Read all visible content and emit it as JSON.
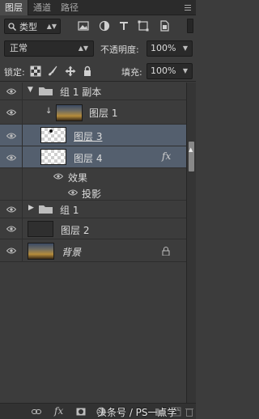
{
  "tabs": [
    {
      "label": "图层"
    },
    {
      "label": "通道"
    },
    {
      "label": "路径"
    }
  ],
  "filter": {
    "kind_label": "类型",
    "icons": [
      "search-icon",
      "image-filter-icon",
      "adjustment-filter-icon",
      "type-filter-icon",
      "shape-filter-icon",
      "smart-object-filter-icon"
    ]
  },
  "blend": {
    "mode": "正常",
    "opacity_label": "不透明度:",
    "opacity_value": "100%"
  },
  "lock": {
    "label": "锁定:",
    "icons": [
      "lock-transparent-icon",
      "lock-pixels-icon",
      "lock-position-icon",
      "lock-all-icon"
    ],
    "fill_label": "填充:",
    "fill_value": "100%"
  },
  "layers": {
    "group_copy": "组 1 副本",
    "layer1": "图层 1",
    "layer3": "图层 3",
    "layer4": "图层 4",
    "layer4_fx": "fx",
    "effects": "效果",
    "drop_shadow": "投影",
    "group1": "组 1",
    "layer2": "图层 2",
    "background": "背景"
  },
  "colors": {
    "panel_bg": "#3c3c3c",
    "selected_row": "#545f6e"
  },
  "bottom": {
    "icons": [
      "link-icon",
      "fx-icon",
      "mask-icon",
      "adjustment-icon",
      "new-group-icon",
      "new-layer-icon",
      "trash-icon"
    ],
    "fx_label": "fx",
    "watermark": "头条号 / PS一点学"
  }
}
